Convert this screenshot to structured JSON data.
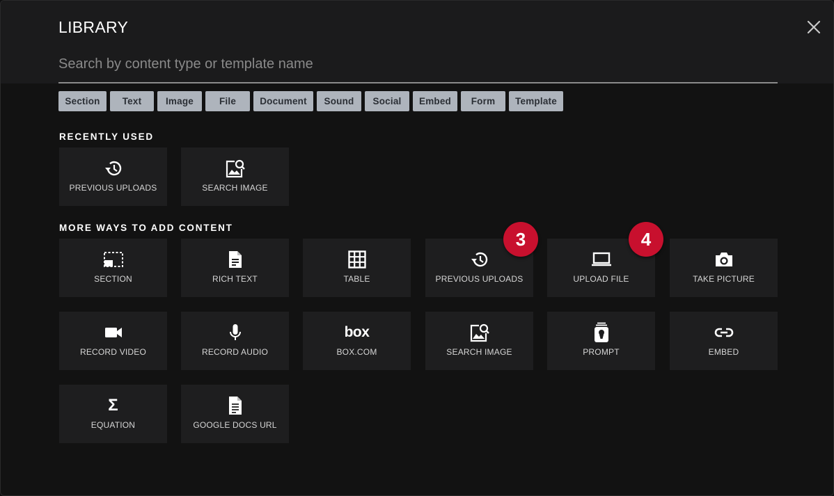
{
  "dialog": {
    "title": "LIBRARY",
    "close_icon": "close-icon"
  },
  "search": {
    "placeholder": "Search by content type or template name",
    "value": ""
  },
  "filters": [
    "Section",
    "Text",
    "Image",
    "File",
    "Document",
    "Sound",
    "Social",
    "Embed",
    "Form",
    "Template"
  ],
  "recently_used": {
    "heading": "RECENTLY USED",
    "items": [
      {
        "label": "PREVIOUS UPLOADS",
        "icon": "history-icon"
      },
      {
        "label": "SEARCH IMAGE",
        "icon": "image-search-icon"
      }
    ]
  },
  "more_ways": {
    "heading": "MORE WAYS TO ADD CONTENT",
    "items": [
      {
        "label": "SECTION",
        "icon": "section-icon"
      },
      {
        "label": "RICH TEXT",
        "icon": "document-icon"
      },
      {
        "label": "TABLE",
        "icon": "table-icon"
      },
      {
        "label": "PREVIOUS UPLOADS",
        "icon": "history-icon"
      },
      {
        "label": "UPLOAD FILE",
        "icon": "laptop-icon"
      },
      {
        "label": "TAKE PICTURE",
        "icon": "camera-icon"
      },
      {
        "label": "RECORD VIDEO",
        "icon": "video-camera-icon"
      },
      {
        "label": "RECORD AUDIO",
        "icon": "microphone-icon"
      },
      {
        "label": "BOX.COM",
        "icon": "box-logo-icon",
        "logo_text": "box"
      },
      {
        "label": "SEARCH IMAGE",
        "icon": "image-search-icon"
      },
      {
        "label": "PROMPT",
        "icon": "prompt-icon"
      },
      {
        "label": "EMBED",
        "icon": "link-icon"
      },
      {
        "label": "EQUATION",
        "icon": "sigma-icon",
        "symbol": "Σ"
      },
      {
        "label": "GOOGLE DOCS URL",
        "icon": "google-doc-icon"
      }
    ]
  },
  "annotations": [
    {
      "number": "3",
      "color": "#c8102e"
    },
    {
      "number": "4",
      "color": "#c8102e"
    }
  ]
}
